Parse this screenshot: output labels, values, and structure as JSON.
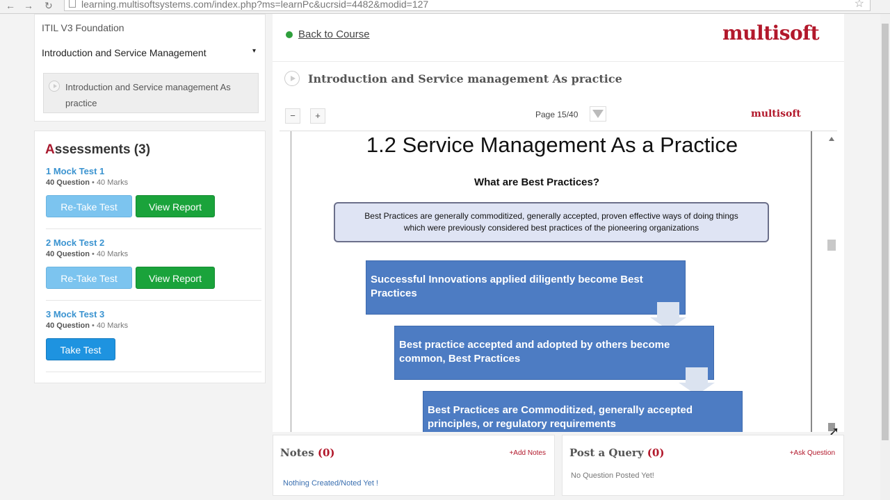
{
  "browser": {
    "url": "learning.multisoftsystems.com/index.php?ms=learnPc&ucrsid=4482&modid=127",
    "back_glyph": "←",
    "reload_glyph": "↻",
    "star_glyph": "☆"
  },
  "sidebar": {
    "course_title": "ITIL V3 Foundation",
    "module_label": "Introduction and Service Management",
    "module_caret": "▾",
    "lesson_label": "Introduction and Service management As practice"
  },
  "assessments": {
    "heading_first": "A",
    "heading_rest": "ssessments (3)",
    "tests": [
      {
        "name": "1 Mock Test 1",
        "questions": "40 Question",
        "marks": "40 Marks",
        "retake_label": "Re-Take Test",
        "report_label": "View Report"
      },
      {
        "name": "2 Mock Test 2",
        "questions": "40 Question",
        "marks": "40 Marks",
        "retake_label": "Re-Take Test",
        "report_label": "View Report"
      },
      {
        "name": "3 Mock Test 3",
        "questions": "40 Question",
        "marks": "40 Marks",
        "take_label": "Take Test"
      }
    ],
    "meta_separator": " • "
  },
  "main": {
    "back_label": "Back to Course",
    "brand": "multisoft",
    "lesson_heading": "Introduction and Service management As practice",
    "viewer": {
      "zoom_out_glyph": "−",
      "zoom_in_glyph": "+",
      "page_info": "Page 15/40",
      "mini_brand": "multisoft"
    },
    "slide": {
      "title": "1.2 Service Management As a Practice",
      "subtitle": "What are Best Practices?",
      "definition_line1": "Best Practices are generally commoditized, generally accepted, proven effective ways of doing things",
      "definition_line2": "which were previously considered best practices of the pioneering organizations",
      "steps": [
        "Successful Innovations applied diligently become Best Practices",
        "Best practice accepted and adopted by others become common, Best Practices",
        "Best Practices are Commoditized, generally accepted principles, or regulatory requirements"
      ]
    }
  },
  "notes": {
    "title": "Notes",
    "count": "(0)",
    "add_label": "+Add Notes",
    "empty_text": "Nothing Created/Noted Yet !"
  },
  "query": {
    "title": "Post a Query",
    "count": "(0)",
    "ask_label": "+Ask Question",
    "empty_text": "No Question Posted Yet!"
  },
  "colors": {
    "brand_red": "#b2182b",
    "link_blue": "#3a93d0",
    "report_green": "#1aa33b",
    "take_blue": "#1e93e0",
    "flow_blue": "#4d7cc3"
  }
}
